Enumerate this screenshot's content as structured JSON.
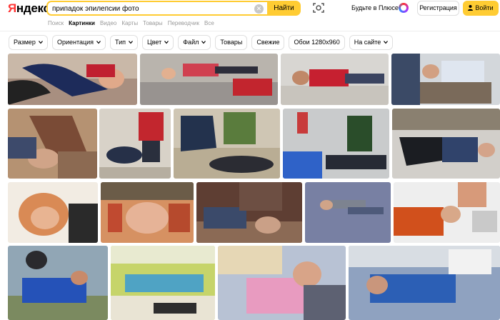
{
  "header": {
    "logo": "Яндекс",
    "search_value": "припадок эпилепсии фото",
    "search_button": "Найти",
    "plus_link": "Будьте в Плюсе",
    "register_button": "Регистрация",
    "login_button": "Войти"
  },
  "tabs": [
    "Поиск",
    "Картинки",
    "Видео",
    "Карты",
    "Товары",
    "Переводчик",
    "Все"
  ],
  "active_tab": "Картинки",
  "filters": [
    {
      "label": "Размер",
      "dropdown": true
    },
    {
      "label": "Ориентация",
      "dropdown": true
    },
    {
      "label": "Тип",
      "dropdown": true
    },
    {
      "label": "Цвет",
      "dropdown": true
    },
    {
      "label": "Файл",
      "dropdown": true
    },
    {
      "label": "Товары",
      "dropdown": false
    },
    {
      "label": "Свежие",
      "dropdown": false
    },
    {
      "label": "Обои 1280x960",
      "dropdown": false
    },
    {
      "label": "На сайте",
      "dropdown": true
    }
  ],
  "colors": {
    "accent": "#ffcc33",
    "logo_red": "#ff3333"
  }
}
